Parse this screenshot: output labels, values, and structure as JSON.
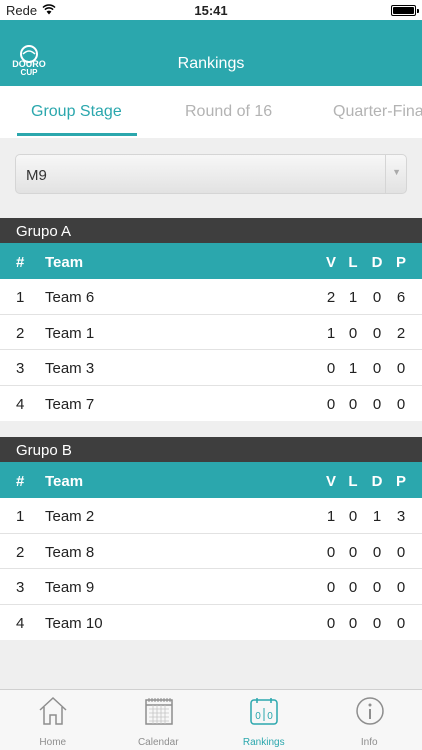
{
  "status_bar": {
    "carrier": "Rede",
    "time": "15:41"
  },
  "nav": {
    "title": "Rankings",
    "logo_text_top": "DOURO",
    "logo_text_bottom": "CUP"
  },
  "tabs": [
    {
      "label": "Group Stage",
      "active": true
    },
    {
      "label": "Round of 16",
      "active": false
    },
    {
      "label": "Quarter-Finals",
      "active": false
    }
  ],
  "category_select": {
    "value": "M9"
  },
  "table_header": {
    "rank": "#",
    "team": "Team",
    "v": "V",
    "l": "L",
    "d": "D",
    "p": "P"
  },
  "groups": [
    {
      "title": "Grupo A",
      "rows": [
        {
          "rank": "1",
          "team": "Team 6",
          "v": "2",
          "l": "1",
          "d": "0",
          "p": "6"
        },
        {
          "rank": "2",
          "team": "Team 1",
          "v": "1",
          "l": "0",
          "d": "0",
          "p": "2"
        },
        {
          "rank": "3",
          "team": "Team 3",
          "v": "0",
          "l": "1",
          "d": "0",
          "p": "0"
        },
        {
          "rank": "4",
          "team": "Team 7",
          "v": "0",
          "l": "0",
          "d": "0",
          "p": "0"
        }
      ]
    },
    {
      "title": "Grupo B",
      "rows": [
        {
          "rank": "1",
          "team": "Team 2",
          "v": "1",
          "l": "0",
          "d": "1",
          "p": "3"
        },
        {
          "rank": "2",
          "team": "Team 8",
          "v": "0",
          "l": "0",
          "d": "0",
          "p": "0"
        },
        {
          "rank": "3",
          "team": "Team 9",
          "v": "0",
          "l": "0",
          "d": "0",
          "p": "0"
        },
        {
          "rank": "4",
          "team": "Team 10",
          "v": "0",
          "l": "0",
          "d": "0",
          "p": "0"
        }
      ]
    }
  ],
  "tab_bar": [
    {
      "label": "Home",
      "icon": "home-icon",
      "active": false
    },
    {
      "label": "Calendar",
      "icon": "calendar-icon",
      "active": false
    },
    {
      "label": "Rankings",
      "icon": "rankings-icon",
      "active": true
    },
    {
      "label": "Info",
      "icon": "info-icon",
      "active": false
    }
  ],
  "colors": {
    "accent": "#2ba7ad",
    "group_header": "#3e3e3e",
    "tab_inactive": "#8e8e8e"
  }
}
